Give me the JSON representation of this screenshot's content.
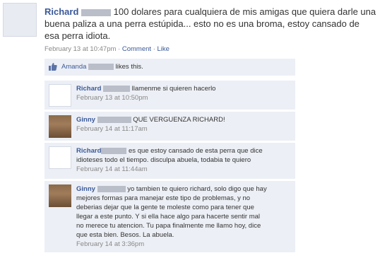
{
  "post": {
    "author": "Richard",
    "text_line1": "100 dolares para cualquiera de mis amigas que quiera darle una",
    "text_line2": "buena paliza a una perra estúpida... esto no es una broma, estoy cansado de",
    "text_line3": "esa perra idiota.",
    "timestamp": "February 13 at 10:47pm",
    "sep1": "·",
    "comment_link": "Comment",
    "sep2": "·",
    "like_link": "Like"
  },
  "likes": {
    "name": "Amanda",
    "suffix": "likes this."
  },
  "comments": [
    {
      "author": "Richard",
      "lines": [
        "llamenme si quieren hacerlo"
      ],
      "timestamp": "February 13 at 10:50pm"
    },
    {
      "author": "Ginny",
      "lines": [
        "QUE VERGUENZA RICHARD!"
      ],
      "timestamp": "February 14 at 11:17am"
    },
    {
      "author": "Richard",
      "lines": [
        "es que estoy cansado de esta perra que dice",
        "idioteses todo el tiempo. disculpa abuela, todabia te quiero"
      ],
      "timestamp": "February 14 at 11:44am"
    },
    {
      "author": "Ginny",
      "lines": [
        "yo tambien te quiero richard, solo digo que hay",
        "mejores formas para manejar este tipo de problemas, y no",
        "deberias dejar que la gente te moleste como para tener que",
        "llegar a este punto. Y si ella hace algo para hacerte sentir mal",
        "no merece tu atencion. Tu papa finalmente me llamo hoy, dice",
        "que esta bien. Besos. La abuela."
      ],
      "timestamp": "February 14 at 3:36pm"
    }
  ],
  "icons": {
    "like": "thumbs-up-icon"
  },
  "colors": {
    "link": "#3b5998",
    "comment_bg": "#eceff5",
    "redaction": "#b9bec9"
  }
}
